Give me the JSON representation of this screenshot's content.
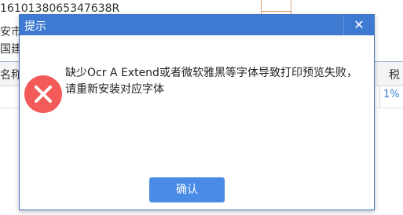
{
  "background": {
    "tax_id": "1610138065347638R",
    "city_fragment": "安市",
    "bank_fragment": "国建",
    "table_head_left": "名称",
    "table_head_right": "税",
    "row_rate": "1%"
  },
  "dialog": {
    "title": "提示",
    "close_glyph": "✕",
    "message": "缺少Ocr A Extend或者微软雅黑等字体导致打印预览失败，请重新安装对应字体",
    "ok_label": "确认"
  },
  "colors": {
    "titlebar": "#3f7ad2",
    "error_icon": "#f25b57",
    "ok_button": "#4a8be6"
  }
}
